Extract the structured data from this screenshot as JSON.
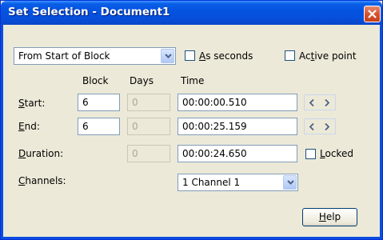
{
  "window": {
    "title": "Set Selection - Document1"
  },
  "top": {
    "mode_combo": "From Start of Block",
    "as_seconds_prefix": "A",
    "as_seconds_rest": "s seconds",
    "active_point_prefix": "Ac",
    "active_point_u": "t",
    "active_point_rest": "ive point"
  },
  "columns": {
    "block": "Block",
    "days": "Days",
    "time": "Time"
  },
  "rows": {
    "start": {
      "label_u": "S",
      "label_rest": "tart:",
      "block": "6",
      "days": "0",
      "time": "00:00:00.510"
    },
    "end": {
      "label_u": "E",
      "label_rest": "nd:",
      "block": "6",
      "days": "0",
      "time": "00:00:25.159"
    },
    "duration": {
      "label_u": "D",
      "label_rest": "uration:",
      "days": "0",
      "time": "00:00:24.650"
    }
  },
  "locked": {
    "label_u": "L",
    "label_rest": "ocked"
  },
  "channels": {
    "label_u": "C",
    "label_rest": "hannels:",
    "value": "1 Channel 1"
  },
  "help": {
    "label_u": "H",
    "label_rest": "elp"
  },
  "colors": {
    "titlebar": "#0553e1",
    "close": "#d8532e",
    "dialog_bg": "#ece9d8"
  }
}
